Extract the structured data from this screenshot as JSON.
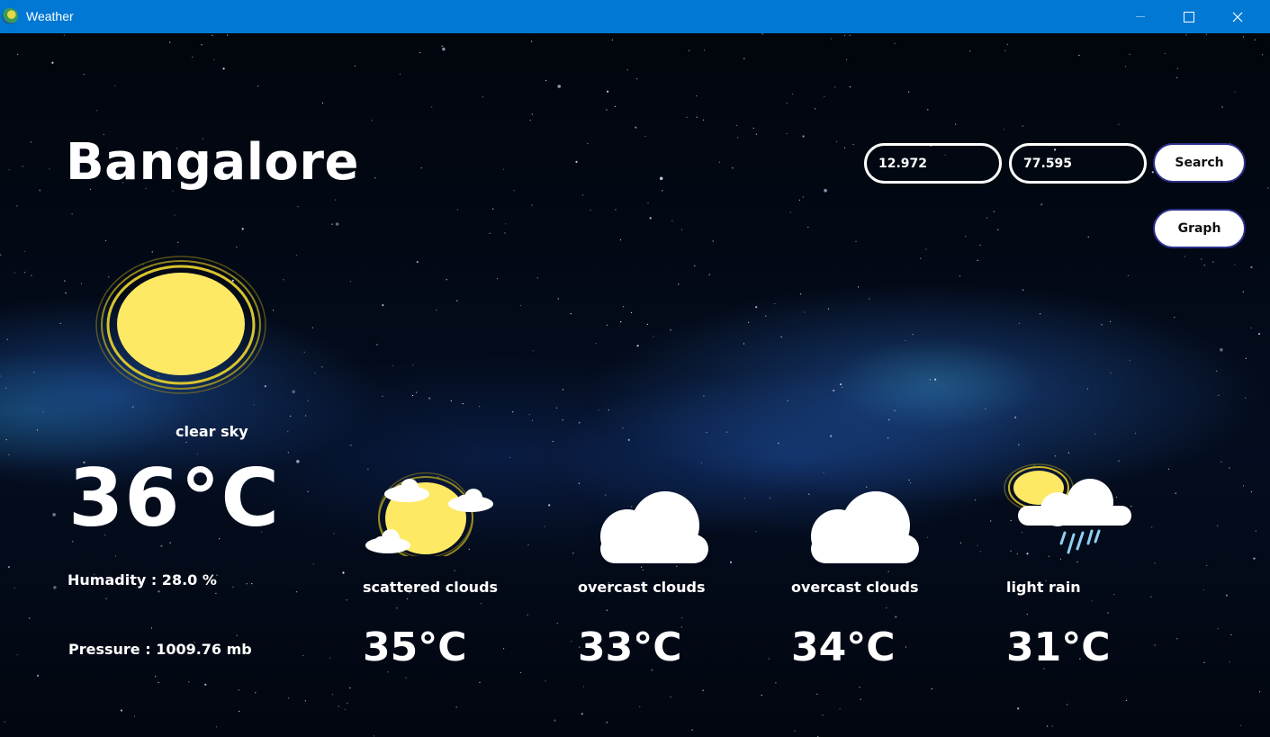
{
  "window": {
    "title": "Weather"
  },
  "city": "Bangalore",
  "search": {
    "lat": "12.972",
    "lon": "77.595",
    "search_label": "Search",
    "graph_label": "Graph"
  },
  "current": {
    "description": "clear sky",
    "temperature": "36°C",
    "humidity": "Humadity : 28.0 %",
    "pressure": "Pressure : 1009.76 mb",
    "icon": "sun-icon"
  },
  "forecast": [
    {
      "description": "scattered clouds",
      "temperature": "35°C",
      "icon": "sun-clouds-icon"
    },
    {
      "description": "overcast clouds",
      "temperature": "33°C",
      "icon": "cloud-icon"
    },
    {
      "description": "overcast clouds",
      "temperature": "34°C",
      "icon": "cloud-icon"
    },
    {
      "description": "light rain",
      "temperature": "31°C",
      "icon": "rain-icon"
    }
  ],
  "colors": {
    "titlebar": "#0078d4",
    "sun": "#fde964",
    "sun_ring": "#c9b62a",
    "cloud": "#ffffff",
    "rain": "#8fd0f2"
  }
}
